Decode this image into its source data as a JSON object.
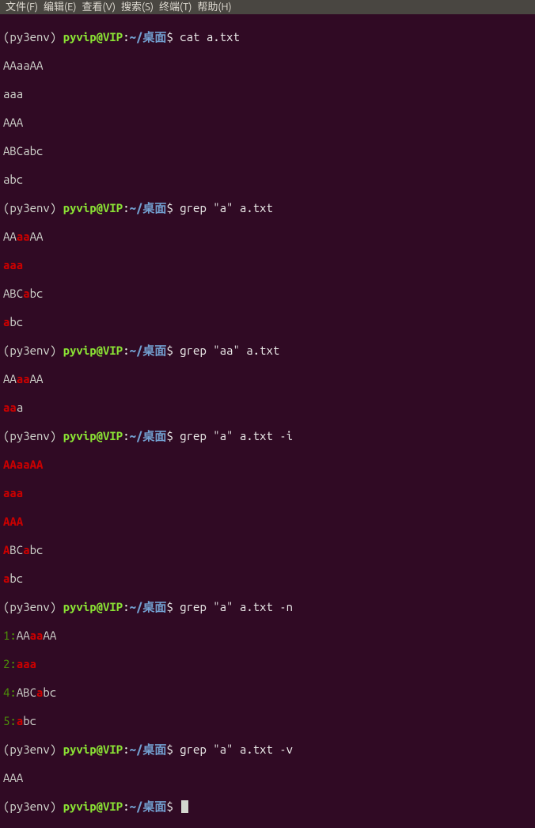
{
  "menu": {
    "file": "文件(F)",
    "edit": "编辑(E)",
    "view": "查看(V)",
    "search": "搜索(S)",
    "terminal": "终端(T)",
    "help": "帮助(H)"
  },
  "prompt": {
    "env": "(py3env) ",
    "user": "pyvip@VIP",
    "colon": ":",
    "path": "~/桌面",
    "dollar": "$ "
  },
  "cmd": {
    "c1": "cat a.txt",
    "c2": "grep \"a\" a.txt",
    "c3": "grep \"aa\" a.txt",
    "c4": "grep \"a\" a.txt -i",
    "c5": "grep \"a\" a.txt -n",
    "c6": "grep \"a\" a.txt -v"
  },
  "cat": {
    "l1": "AAaaAA",
    "l2": "aaa",
    "l3": "AAA",
    "l4": "ABCabc",
    "l5": "abc"
  },
  "g1": {
    "l1a": "AA",
    "l1b": "aa",
    "l1c": "AA",
    "l2": "aaa",
    "l3a": "ABC",
    "l3b": "a",
    "l3c": "bc",
    "l4a": "a",
    "l4b": "bc"
  },
  "g2": {
    "l1a": "AA",
    "l1b": "aa",
    "l1c": "AA",
    "l2a": "aa",
    "l2b": "a"
  },
  "g3": {
    "l1": "AAaaAA",
    "l2": "aaa",
    "l3": "AAA",
    "l4a": "A",
    "l4b": "BC",
    "l4c": "a",
    "l4d": "bc",
    "l5a": "a",
    "l5b": "bc"
  },
  "g4": {
    "n1": "1:",
    "l1a": "AA",
    "l1b": "aa",
    "l1c": "AA",
    "n2": "2:",
    "l2": "aaa",
    "n4": "4:",
    "l4a": "ABC",
    "l4b": "a",
    "l4c": "bc",
    "n5": "5:",
    "l5a": "a",
    "l5b": "bc"
  },
  "g5": {
    "l1": "AAA"
  }
}
